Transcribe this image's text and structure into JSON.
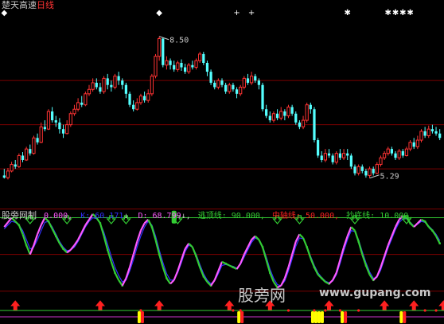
{
  "header": {
    "name": "楚天高速",
    "period": "日线"
  },
  "colors": {
    "background": "#000000",
    "grid": "#7a0000",
    "up": "#ff3333",
    "down": "#54ffff",
    "text": "#c8c8c8",
    "white": "#ffffff",
    "kline": "#ff5aff",
    "dline": "#3030ff",
    "green": "#33cc33",
    "yellow": "#ffff00",
    "red": "#ff2020",
    "border_line": "#33cc33",
    "purple_line": "#cc33cc"
  },
  "indicator": {
    "name": "股旁网制",
    "o_label": "0.000,",
    "k_label": "K: 60.171",
    "d_label": "D: 68.799",
    "escape_label": "逃顶线: 90.000,",
    "mid_label": "中轴线: 50.000,",
    "bottom_label": "抄底线: 10.000,"
  },
  "watermark": {
    "text": "股旁网",
    "url": "www.gupang.com"
  },
  "chart_data": [
    {
      "type": "candlestick",
      "title": "楚天高速 日线",
      "ylim": [
        4.6,
        9.0
      ],
      "annotations": [
        {
          "text": "8.50",
          "kind": "high",
          "value": 8.5,
          "index": 42
        },
        {
          "text": "5.29",
          "kind": "low",
          "value": 5.29,
          "index": 99
        }
      ],
      "candles": [
        [
          5.35,
          5.3,
          5.5,
          5.28
        ],
        [
          5.3,
          5.45,
          5.52,
          5.26
        ],
        [
          5.45,
          5.6,
          5.66,
          5.42
        ],
        [
          5.6,
          5.55,
          5.7,
          5.5
        ],
        [
          5.55,
          5.8,
          5.85,
          5.52
        ],
        [
          5.8,
          5.7,
          5.88,
          5.65
        ],
        [
          5.7,
          5.95,
          6.0,
          5.68
        ],
        [
          5.95,
          5.85,
          6.05,
          5.8
        ],
        [
          5.85,
          6.2,
          6.25,
          5.82
        ],
        [
          6.2,
          6.1,
          6.3,
          6.05
        ],
        [
          6.1,
          6.45,
          6.55,
          6.08
        ],
        [
          6.45,
          6.4,
          6.6,
          6.35
        ],
        [
          6.4,
          6.8,
          6.85,
          6.38
        ],
        [
          6.8,
          6.6,
          6.9,
          6.55
        ],
        [
          6.6,
          6.55,
          6.7,
          6.45
        ],
        [
          6.55,
          6.4,
          6.65,
          6.3
        ],
        [
          6.4,
          6.3,
          6.5,
          6.2
        ],
        [
          6.3,
          6.5,
          6.6,
          6.28
        ],
        [
          6.5,
          6.75,
          6.8,
          6.45
        ],
        [
          6.75,
          6.85,
          6.95,
          6.7
        ],
        [
          6.85,
          7.0,
          7.1,
          6.8
        ],
        [
          7.0,
          6.95,
          7.15,
          6.9
        ],
        [
          6.95,
          7.2,
          7.25,
          6.92
        ],
        [
          7.2,
          7.3,
          7.4,
          7.15
        ],
        [
          7.3,
          7.45,
          7.55,
          7.25
        ],
        [
          7.45,
          7.35,
          7.55,
          7.3
        ],
        [
          7.35,
          7.25,
          7.45,
          7.2
        ],
        [
          7.25,
          7.55,
          7.6,
          7.2
        ],
        [
          7.55,
          7.4,
          7.65,
          7.3
        ],
        [
          7.4,
          7.35,
          7.5,
          7.25
        ],
        [
          7.35,
          7.6,
          7.65,
          7.3
        ],
        [
          7.6,
          7.5,
          7.7,
          7.4
        ],
        [
          7.5,
          7.4,
          7.55,
          7.3
        ],
        [
          7.4,
          7.2,
          7.45,
          7.1
        ],
        [
          7.2,
          6.95,
          7.25,
          6.9
        ],
        [
          6.95,
          6.85,
          7.05,
          6.8
        ],
        [
          6.85,
          7.0,
          7.1,
          6.82
        ],
        [
          7.0,
          7.15,
          7.2,
          6.95
        ],
        [
          7.15,
          7.05,
          7.25,
          7.0
        ],
        [
          7.05,
          7.2,
          7.3,
          7.0
        ],
        [
          7.2,
          7.6,
          7.65,
          7.15
        ],
        [
          7.6,
          8.05,
          8.1,
          7.55
        ],
        [
          8.05,
          8.45,
          8.5,
          7.95
        ],
        [
          8.45,
          7.85,
          8.48,
          7.8
        ],
        [
          7.85,
          7.95,
          8.05,
          7.75
        ],
        [
          7.95,
          7.85,
          8.0,
          7.75
        ],
        [
          7.85,
          7.75,
          7.95,
          7.7
        ],
        [
          7.75,
          7.9,
          7.95,
          7.7
        ],
        [
          7.9,
          7.8,
          7.98,
          7.72
        ],
        [
          7.8,
          7.7,
          7.88,
          7.65
        ],
        [
          7.7,
          7.85,
          7.9,
          7.65
        ],
        [
          7.85,
          7.8,
          7.95,
          7.75
        ],
        [
          7.8,
          7.95,
          8.0,
          7.75
        ],
        [
          7.95,
          8.1,
          8.15,
          7.9
        ],
        [
          8.1,
          7.9,
          8.15,
          7.85
        ],
        [
          7.9,
          7.7,
          7.95,
          7.6
        ],
        [
          7.7,
          7.45,
          7.75,
          7.4
        ],
        [
          7.45,
          7.35,
          7.5,
          7.3
        ],
        [
          7.35,
          7.5,
          7.55,
          7.3
        ],
        [
          7.5,
          7.4,
          7.55,
          7.35
        ],
        [
          7.4,
          7.25,
          7.45,
          7.2
        ],
        [
          7.25,
          7.4,
          7.45,
          7.2
        ],
        [
          7.4,
          7.3,
          7.45,
          7.25
        ],
        [
          7.3,
          7.2,
          7.35,
          7.1
        ],
        [
          7.2,
          7.35,
          7.4,
          7.15
        ],
        [
          7.35,
          7.55,
          7.6,
          7.3
        ],
        [
          7.55,
          7.45,
          7.65,
          7.4
        ],
        [
          7.45,
          7.6,
          7.7,
          7.4
        ],
        [
          7.6,
          7.5,
          7.65,
          7.45
        ],
        [
          7.5,
          7.4,
          7.55,
          7.3
        ],
        [
          7.4,
          6.85,
          7.45,
          6.8
        ],
        [
          6.85,
          6.7,
          6.95,
          6.65
        ],
        [
          6.7,
          6.6,
          6.8,
          6.55
        ],
        [
          6.6,
          6.75,
          6.8,
          6.55
        ],
        [
          6.75,
          6.65,
          6.85,
          6.6
        ],
        [
          6.65,
          6.8,
          6.9,
          6.6
        ],
        [
          6.8,
          6.7,
          6.85,
          6.6
        ],
        [
          6.7,
          6.9,
          6.95,
          6.65
        ],
        [
          6.9,
          6.75,
          6.95,
          6.7
        ],
        [
          6.75,
          6.55,
          6.8,
          6.5
        ],
        [
          6.55,
          6.45,
          6.6,
          6.4
        ],
        [
          6.45,
          6.6,
          6.7,
          6.4
        ],
        [
          6.6,
          6.95,
          7.0,
          6.55
        ],
        [
          6.95,
          6.85,
          7.0,
          6.75
        ],
        [
          6.85,
          6.15,
          6.9,
          6.1
        ],
        [
          6.15,
          5.8,
          6.2,
          5.75
        ],
        [
          5.8,
          5.7,
          5.9,
          5.65
        ],
        [
          5.7,
          5.85,
          5.95,
          5.65
        ],
        [
          5.85,
          5.8,
          5.95,
          5.75
        ],
        [
          5.8,
          5.65,
          5.85,
          5.6
        ],
        [
          5.65,
          5.85,
          5.9,
          5.6
        ],
        [
          5.85,
          5.75,
          5.95,
          5.7
        ],
        [
          5.75,
          5.85,
          5.95,
          5.7
        ],
        [
          5.85,
          5.8,
          5.95,
          5.7
        ],
        [
          5.8,
          5.55,
          5.85,
          5.5
        ],
        [
          5.55,
          5.4,
          5.6,
          5.35
        ],
        [
          5.4,
          5.55,
          5.6,
          5.35
        ],
        [
          5.55,
          5.45,
          5.6,
          5.4
        ],
        [
          5.45,
          5.35,
          5.5,
          5.3
        ],
        [
          5.35,
          5.5,
          5.55,
          5.29
        ],
        [
          5.5,
          5.4,
          5.55,
          5.35
        ],
        [
          5.4,
          5.6,
          5.65,
          5.38
        ],
        [
          5.6,
          5.75,
          5.8,
          5.55
        ],
        [
          5.75,
          5.85,
          5.9,
          5.7
        ],
        [
          5.85,
          5.95,
          6.0,
          5.8
        ],
        [
          5.95,
          5.85,
          6.0,
          5.8
        ],
        [
          5.85,
          5.75,
          5.9,
          5.7
        ],
        [
          5.75,
          5.9,
          5.95,
          5.7
        ],
        [
          5.9,
          5.8,
          5.95,
          5.75
        ],
        [
          5.8,
          5.95,
          6.0,
          5.78
        ],
        [
          5.95,
          6.1,
          6.15,
          5.9
        ],
        [
          6.1,
          6.0,
          6.2,
          5.95
        ],
        [
          6.0,
          6.15,
          6.25,
          5.95
        ],
        [
          6.15,
          6.35,
          6.4,
          6.1
        ],
        [
          6.35,
          6.25,
          6.45,
          6.2
        ],
        [
          6.25,
          6.4,
          6.48,
          6.2
        ],
        [
          6.4,
          6.35,
          6.5,
          6.3
        ],
        [
          6.35,
          6.3,
          6.45,
          6.25
        ],
        [
          6.3,
          6.2,
          6.4,
          6.15
        ]
      ],
      "markers": [
        {
          "index": 0,
          "symbol": "◆"
        },
        {
          "index": 42,
          "symbol": "◆"
        },
        {
          "index": 63,
          "symbol": "+"
        },
        {
          "index": 67,
          "symbol": "+"
        },
        {
          "index": 93,
          "symbol": "✱"
        },
        {
          "index": 104,
          "symbol": "✱"
        },
        {
          "index": 106,
          "symbol": "✱"
        },
        {
          "index": 108,
          "symbol": "✱"
        },
        {
          "index": 110,
          "symbol": "✱"
        }
      ]
    },
    {
      "type": "line",
      "title": "股旁网制",
      "ylim": [
        -5,
        100
      ],
      "reference_lines": [
        {
          "name": "逃顶线",
          "value": 90
        },
        {
          "name": "中轴线",
          "value": 50
        },
        {
          "name": "抄底线",
          "value": 10
        },
        {
          "name": "",
          "value": 0
        }
      ],
      "series": [
        {
          "name": "K",
          "values": [
            80,
            85,
            90,
            86,
            82,
            72,
            60,
            50,
            60,
            72,
            82,
            90,
            86,
            78,
            70,
            62,
            56,
            52,
            55,
            60,
            66,
            74,
            82,
            88,
            94,
            90,
            84,
            70,
            55,
            42,
            30,
            22,
            16,
            24,
            36,
            50,
            64,
            76,
            84,
            88,
            80,
            66,
            50,
            36,
            24,
            18,
            22,
            32,
            44,
            56,
            62,
            58,
            48,
            36,
            26,
            20,
            16,
            22,
            32,
            42,
            40,
            38,
            36,
            34,
            40,
            50,
            58,
            66,
            70,
            66,
            58,
            44,
            30,
            20,
            14,
            16,
            24,
            36,
            50,
            64,
            72,
            68,
            58,
            46,
            36,
            28,
            24,
            20,
            18,
            22,
            30,
            44,
            58,
            70,
            80,
            76,
            64,
            50,
            38,
            28,
            22,
            26,
            36,
            48,
            60,
            70,
            80,
            88,
            92,
            90,
            84,
            80,
            84,
            88,
            86,
            80,
            76,
            70,
            62,
            58
          ]
        },
        {
          "name": "D",
          "values": [
            78,
            82,
            86,
            85,
            82,
            76,
            66,
            56,
            58,
            66,
            76,
            85,
            86,
            80,
            72,
            64,
            58,
            54,
            55,
            58,
            64,
            72,
            80,
            86,
            90,
            89,
            84,
            74,
            61,
            48,
            36,
            27,
            20,
            22,
            32,
            44,
            58,
            70,
            80,
            86,
            82,
            70,
            55,
            41,
            29,
            22,
            22,
            30,
            41,
            53,
            60,
            58,
            50,
            39,
            29,
            22,
            18,
            21,
            29,
            38,
            39,
            38,
            37,
            35,
            39,
            47,
            55,
            63,
            68,
            66,
            59,
            47,
            34,
            24,
            17,
            16,
            21,
            32,
            45,
            59,
            68,
            67,
            59,
            48,
            38,
            30,
            25,
            21,
            19,
            21,
            28,
            40,
            54,
            66,
            76,
            75,
            66,
            53,
            41,
            31,
            24,
            25,
            33,
            45,
            57,
            67,
            77,
            85,
            89,
            89,
            85,
            81,
            83,
            86,
            85,
            81,
            77,
            72,
            65,
            60
          ]
        }
      ],
      "markers": {
        "bars": [
          46,
          133
        ],
        "down_arrows": [
          7,
          17,
          29,
          33,
          47,
          74,
          80,
          95,
          109,
          124,
          134
        ],
        "up_arrows": [
          3,
          26,
          42,
          61,
          72,
          88,
          103,
          111,
          119,
          132
        ],
        "dots": [
          37,
          62,
          64,
          77,
          84,
          87,
          91,
          96,
          114,
          117,
          124
        ],
        "signal_blocks": [
          {
            "index": 37,
            "colors": [
              "#ffff00",
              "#ff2020"
            ]
          },
          {
            "index": 64,
            "colors": [
              "#ffff00",
              "#ff2020"
            ]
          },
          {
            "index": 84,
            "colors": [
              "#ffff00",
              "#ffff00",
              "#ffff00",
              "#ffff00"
            ]
          },
          {
            "index": 92,
            "colors": [
              "#ffff00",
              "#ff2020"
            ]
          },
          {
            "index": 108,
            "colors": [
              "#ffff00",
              "#ff2020"
            ]
          }
        ]
      }
    }
  ]
}
